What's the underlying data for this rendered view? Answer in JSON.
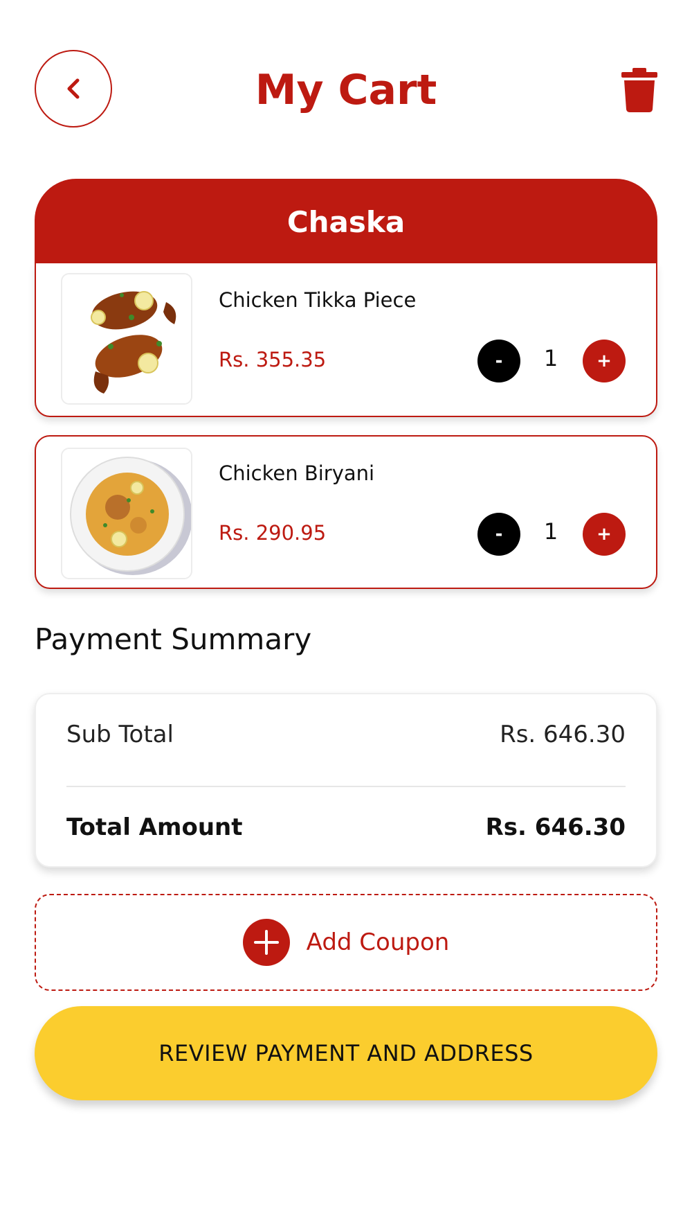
{
  "header": {
    "title": "My Cart",
    "back_icon": "chevron-left-icon",
    "delete_icon": "trash-icon"
  },
  "restaurant": {
    "name": "Chaska"
  },
  "cart": {
    "items": [
      {
        "name": "Chicken Tikka Piece",
        "price": "Rs. 355.35",
        "quantity": "1",
        "minus_label": "-",
        "plus_label": "+",
        "image": "chicken-tikka-image"
      },
      {
        "name": "Chicken Biryani",
        "price": "Rs. 290.95",
        "quantity": "1",
        "minus_label": "-",
        "plus_label": "+",
        "image": "chicken-biryani-image"
      }
    ]
  },
  "summary": {
    "title": "Payment Summary",
    "subtotal_label": "Sub Total",
    "subtotal_value": "Rs. 646.30",
    "total_label": "Total Amount",
    "total_value": "Rs. 646.30"
  },
  "coupon": {
    "label": "Add Coupon",
    "icon": "plus-circle-icon"
  },
  "cta": {
    "label": "REVIEW PAYMENT AND ADDRESS"
  },
  "colors": {
    "primary": "#bd1a11",
    "accent": "#fbcd2e",
    "text": "#111111"
  }
}
